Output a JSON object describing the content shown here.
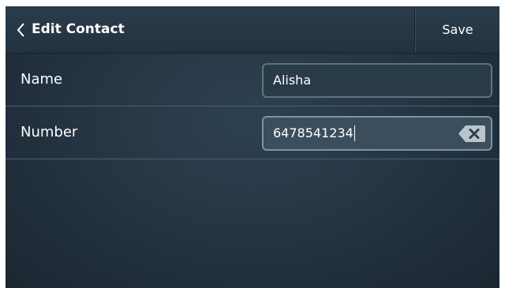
{
  "header": {
    "back_icon": "chevron-left-icon",
    "title": "Edit Contact",
    "save_label": "Save"
  },
  "form": {
    "name": {
      "label": "Name",
      "value": "Alisha"
    },
    "number": {
      "label": "Number",
      "value": "6478541234",
      "clear_icon": "backspace-clear-icon"
    }
  }
}
